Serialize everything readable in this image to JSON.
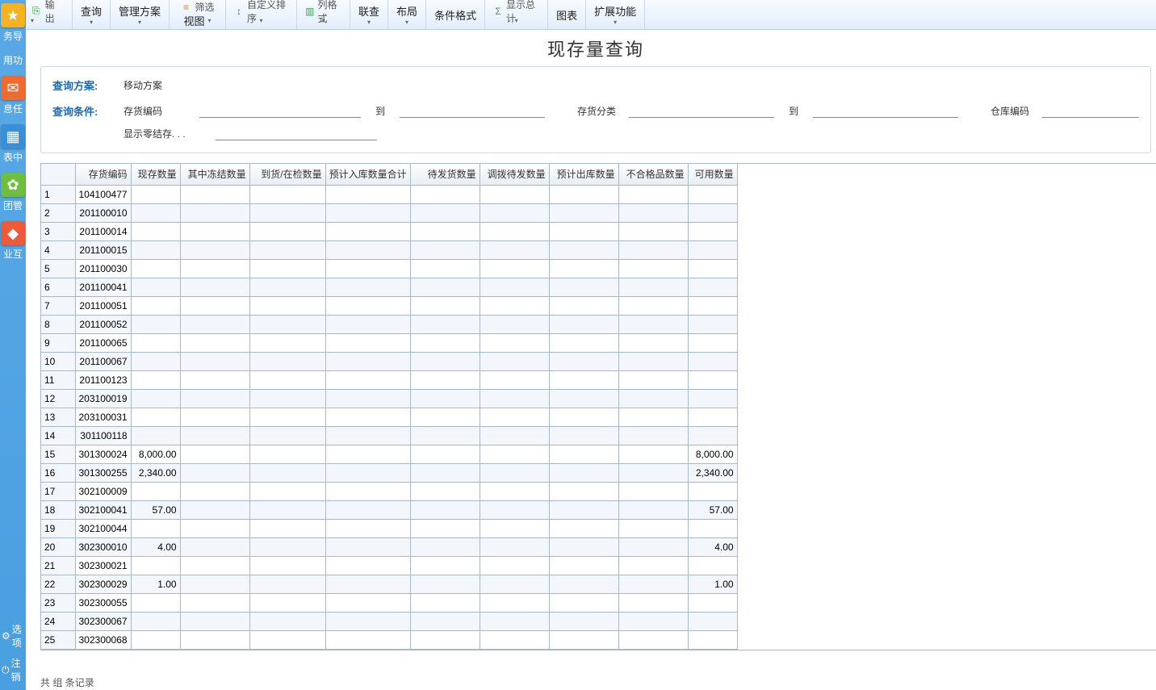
{
  "sidebar": {
    "items": [
      {
        "label": "务导",
        "icon": "★",
        "bg": "#f5b324"
      },
      {
        "label": "用功",
        "icon": "",
        "bg": ""
      },
      {
        "label": "息任",
        "icon": "✉",
        "bg": "#ef6a2f"
      },
      {
        "label": "表中",
        "icon": "▦",
        "bg": "#3b8fd6"
      },
      {
        "label": "团管",
        "icon": "✿",
        "bg": "#6fbf3f"
      },
      {
        "label": "业互",
        "icon": "◆",
        "bg": "#ef5a3a"
      }
    ],
    "bottom": {
      "opt": "选项",
      "logout": "注销"
    }
  },
  "toolbar": {
    "export_top": "输出",
    "export_main": "",
    "query": "查询",
    "plan": "管理方案",
    "filter_top": "筛选",
    "filter_main": "视图",
    "sort_top": "自定义排序",
    "sort_main": "",
    "col_top": "列格式",
    "col_main": "",
    "join": "联查",
    "layout": "布局",
    "cond": "条件格式",
    "sum_top": "显示总计",
    "sum_main": "",
    "chart": "图表",
    "ext": "扩展功能"
  },
  "title": "现存量查询",
  "query": {
    "scheme_label": "查询方案:",
    "scheme_val": "移动方案",
    "cond_label": "查询条件:",
    "c1": "存货编码",
    "to": "到",
    "c2": "存货分类",
    "to2": "到",
    "c3": "仓库编码",
    "c4": "显示零结存. . ."
  },
  "table": {
    "headers": [
      "存货编码",
      "现存数量",
      "其中冻结数量",
      "到货/在检数量",
      "预计入库数量合计",
      "待发货数量",
      "调拨待发数量",
      "预计出库数量",
      "不合格品数量",
      "可用数量"
    ],
    "rows": [
      {
        "n": "1",
        "code": "104100477"
      },
      {
        "n": "2",
        "code": "201100010"
      },
      {
        "n": "3",
        "code": "201100014"
      },
      {
        "n": "4",
        "code": "201100015"
      },
      {
        "n": "5",
        "code": "201100030"
      },
      {
        "n": "6",
        "code": "201100041"
      },
      {
        "n": "7",
        "code": "201100051"
      },
      {
        "n": "8",
        "code": "201100052"
      },
      {
        "n": "9",
        "code": "201100065"
      },
      {
        "n": "10",
        "code": "201100067"
      },
      {
        "n": "11",
        "code": "201100123"
      },
      {
        "n": "12",
        "code": "203100019"
      },
      {
        "n": "13",
        "code": "203100031"
      },
      {
        "n": "14",
        "code": "301100118"
      },
      {
        "n": "15",
        "code": "301300024",
        "qty": "8,000.00",
        "avail": "8,000.00"
      },
      {
        "n": "16",
        "code": "301300255",
        "qty": "2,340.00",
        "avail": "2,340.00"
      },
      {
        "n": "17",
        "code": "302100009"
      },
      {
        "n": "18",
        "code": "302100041",
        "qty": "57.00",
        "avail": "57.00"
      },
      {
        "n": "19",
        "code": "302100044"
      },
      {
        "n": "20",
        "code": "302300010",
        "qty": "4.00",
        "avail": "4.00"
      },
      {
        "n": "21",
        "code": "302300021"
      },
      {
        "n": "22",
        "code": "302300029",
        "qty": "1.00",
        "avail": "1.00"
      },
      {
        "n": "23",
        "code": "302300055"
      },
      {
        "n": "24",
        "code": "302300067"
      },
      {
        "n": "25",
        "code": "302300068"
      }
    ]
  },
  "footer": {
    "prefix": "共 ",
    "mid": " 组  ",
    "suffix": " 条记录"
  }
}
